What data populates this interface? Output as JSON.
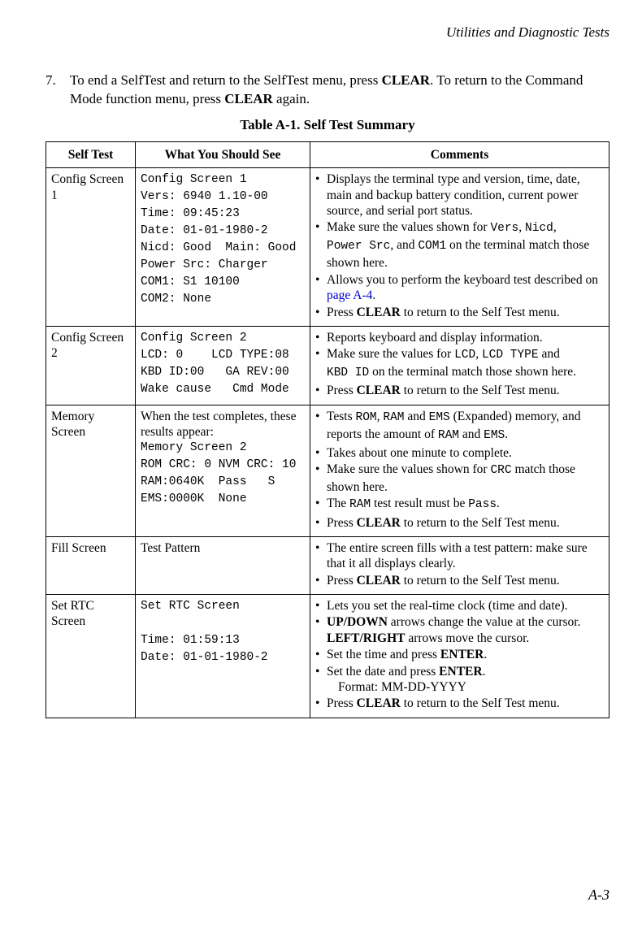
{
  "running_head": "Utilities and Diagnostic Tests",
  "step": {
    "num": "7.",
    "t1": "To end a SelfTest and return to the SelfTest menu, press  ",
    "b1": "CLEAR",
    "t2": ". To return to the Command Mode function menu, press ",
    "b2": "CLEAR",
    "t3": " again."
  },
  "table_caption": "Table A-1. Self Test Summary",
  "headers": {
    "c1": "Self Test",
    "c2": "What You Should See",
    "c3": "Comments"
  },
  "row1": {
    "name": "Config Screen 1",
    "mono": "Config Screen 1\nVers: 6940 1.10-00\nTime: 09:45:23\nDate: 01-01-1980-2\nNicd: Good  Main: Good\nPower Src: Charger\nCOM1: S1 10100\nCOM2: None",
    "b1": "Displays the terminal type and version, time, date, main and backup battery condition, current power source, and serial port status.",
    "b2a": "Make sure the values shown for ",
    "b2m1": "Vers",
    "b2b": ", ",
    "b2m2": "Nicd",
    "b2c": ", ",
    "b2m3": "Power Src",
    "b2d": ", and ",
    "b2m4": "COM1",
    "b2e": " on the terminal match those shown here.",
    "b3a": "Allows you to perform the keyboard test described on ",
    "b3link": "page A-4",
    "b3b": ".",
    "b4a": "Press ",
    "b4bold": "CLEAR",
    "b4b": " to return to the Self Test menu."
  },
  "row2": {
    "name": "Config Screen 2",
    "mono": "Config Screen 2\nLCD: 0    LCD TYPE:08\nKBD ID:00   GA REV:00\nWake cause   Cmd Mode",
    "b1": "Reports keyboard and display information.",
    "b2a": "Make sure the values for ",
    "b2m1": "LCD",
    "b2b": ", ",
    "b2m2": "LCD TYPE",
    "b2c": " and ",
    "b2m3": "KBD ID",
    "b2d": " on the terminal match those shown here.",
    "b3a": "Press ",
    "b3bold": "CLEAR",
    "b3b": " to return to the Self Test menu."
  },
  "row3": {
    "name": "Memory Screen",
    "intro": "When the test completes, these results appear:",
    "mono": "Memory Screen 2\nROM CRC: 0 NVM CRC: 10\nRAM:0640K  Pass   S\nEMS:0000K  None",
    "b1a": "Tests ",
    "b1m1": "ROM",
    "b1b": ", ",
    "b1m2": "RAM",
    "b1c": " and ",
    "b1m3": "EMS",
    "b1d": " (Expanded) memory, and reports the amount of ",
    "b1m4": "RAM",
    "b1e": " and ",
    "b1m5": "EMS",
    "b1f": ".",
    "b2": "Takes about one minute to complete.",
    "b3a": "Make sure the values shown for ",
    "b3m1": "CRC",
    "b3b": " match those shown here.",
    "b4a": "The ",
    "b4m1": "RAM",
    "b4b": " test result must be ",
    "b4m2": "Pass",
    "b4c": ".",
    "b5a": "Press ",
    "b5bold": "CLEAR",
    "b5b": " to return to the Self Test menu."
  },
  "row4": {
    "name": "Fill Screen",
    "col2": "Test Pattern",
    "b1": "The entire screen fills with a test pattern: make sure that it all displays clearly.",
    "b2a": "Press ",
    "b2bold": "CLEAR",
    "b2b": " to return to the Self Test menu."
  },
  "row5": {
    "name": "Set RTC Screen",
    "mono": "Set RTC Screen\n\nTime: 01:59:13\nDate: 01-01-1980-2",
    "b1": "Lets you set the real-time clock (time and date).",
    "b2bold1": "UP/DOWN",
    "b2a": " arrows change the value at the cursor. ",
    "b2bold2": "LEFT/RIGHT",
    "b2b": " arrows move the cursor.",
    "b3a": "Set the time and press ",
    "b3bold": "ENTER",
    "b3b": ".",
    "b4a": "Set the date and press ",
    "b4bold": "ENTER",
    "b4b": ".",
    "b4sub": "Format: MM-DD-YYYY",
    "b5a": "Press ",
    "b5bold": "CLEAR",
    "b5b": " to return to the Self Test menu."
  },
  "page_num": "A-3"
}
